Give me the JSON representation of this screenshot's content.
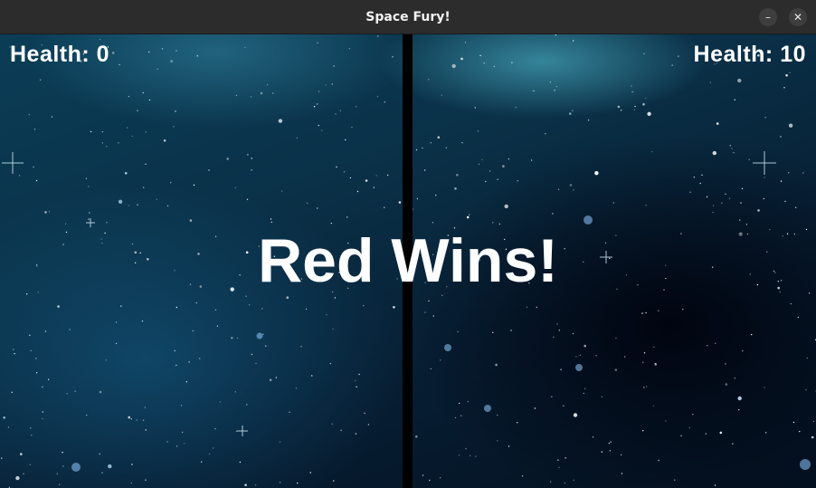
{
  "window": {
    "title": "Space Fury!",
    "minimize_glyph": "–",
    "close_glyph": "✕"
  },
  "hud": {
    "left_health": "Health: 0",
    "right_health": "Health: 10"
  },
  "result": {
    "message": "Red Wins!"
  },
  "colors": {
    "text": "#ffffff",
    "titlebar": "#2c2c2c",
    "divider": "#000000"
  }
}
